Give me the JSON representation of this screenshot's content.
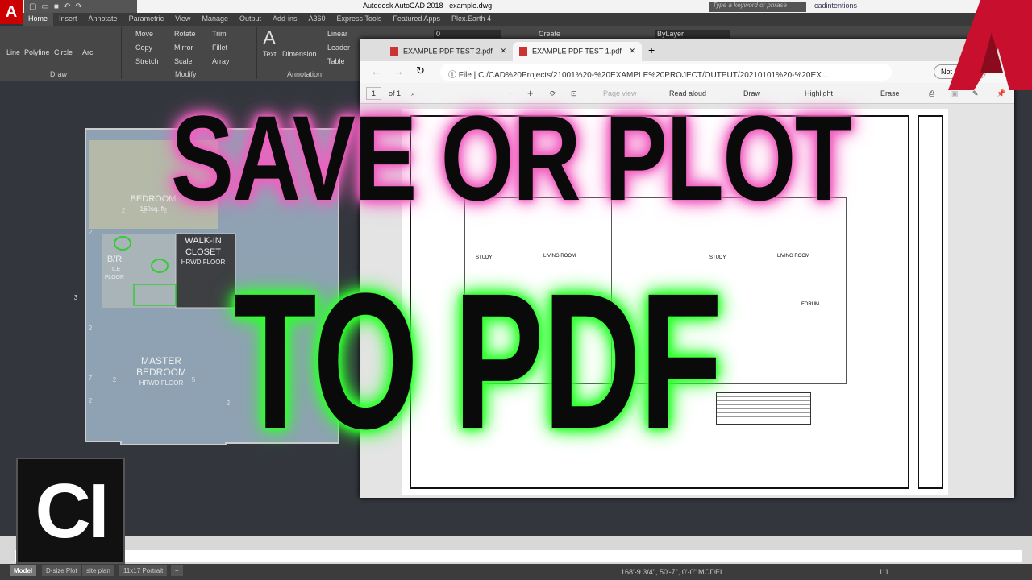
{
  "app": {
    "title": "Autodesk AutoCAD 2018",
    "file": "example.dwg",
    "logo": "A",
    "search_placeholder": "Type a keyword or phrase",
    "user": "cadintentions"
  },
  "ribbon_tabs": [
    "Home",
    "Insert",
    "Annotate",
    "Parametric",
    "View",
    "Manage",
    "Output",
    "Add-ins",
    "A360",
    "Express Tools",
    "Featured Apps",
    "Plex.Earth 4"
  ],
  "ribbon": {
    "draw": [
      "Line",
      "Polyline",
      "Circle",
      "Arc"
    ],
    "draw_label": "Draw",
    "modify": [
      "Move",
      "Rotate",
      "Trim",
      "Copy",
      "Mirror",
      "Fillet",
      "Stretch",
      "Scale",
      "Array"
    ],
    "modify_label": "Modify",
    "annotation": [
      "Text",
      "Dimension",
      "Linear",
      "Leader",
      "Table"
    ],
    "annotation_label": "Annotation",
    "layer": "0",
    "create": "Create",
    "bylayer": "ByLayer"
  },
  "floorplan": {
    "rooms": [
      "BEDROOM",
      "160sq. ft.",
      "WALK-IN",
      "CLOSET",
      "HRWD FLOOR",
      "B/R",
      "TILE",
      "FLOOR",
      "MASTER",
      "BEDROOM",
      "HRWD FLOOR"
    ],
    "tags": [
      "2",
      "2",
      "2",
      "2",
      "3",
      "2",
      "7",
      "2",
      "5",
      "2",
      "2",
      "3",
      "2",
      "2",
      "6",
      "4",
      "4",
      "4"
    ]
  },
  "pdf": {
    "tabs": [
      "EXAMPLE PDF TEST 2.pdf",
      "EXAMPLE PDF TEST 1.pdf"
    ],
    "file_label": "File",
    "url": "C:/CAD%20Projects/21001%20-%20EXAMPLE%20PROJECT/OUTPUT/20210101%20-%20EX...",
    "page": "1",
    "of": "of 1",
    "page_view": "Page view",
    "read_aloud": "Read aloud",
    "draw": "Draw",
    "highlight": "Highlight",
    "erase": "Erase",
    "sync": "Not syncing",
    "plan_labels": [
      "STUDY",
      "LIVING ROOM",
      "STUDY",
      "LIVING ROOM",
      "FORUM"
    ]
  },
  "overlay": {
    "line1": "SAVE OR PLOT",
    "line2": "TO PDF",
    "badge": "CI",
    "glow1": "#f060c0",
    "glow2": "#30ff30"
  },
  "status": {
    "layouts": [
      "Model",
      "D-size Plot",
      "site plan",
      "11x17 Portrait"
    ],
    "coords": "168'-9 3/4\", 50'-7\", 0'-0\"",
    "mode": "MODEL",
    "scale": "1:1"
  }
}
